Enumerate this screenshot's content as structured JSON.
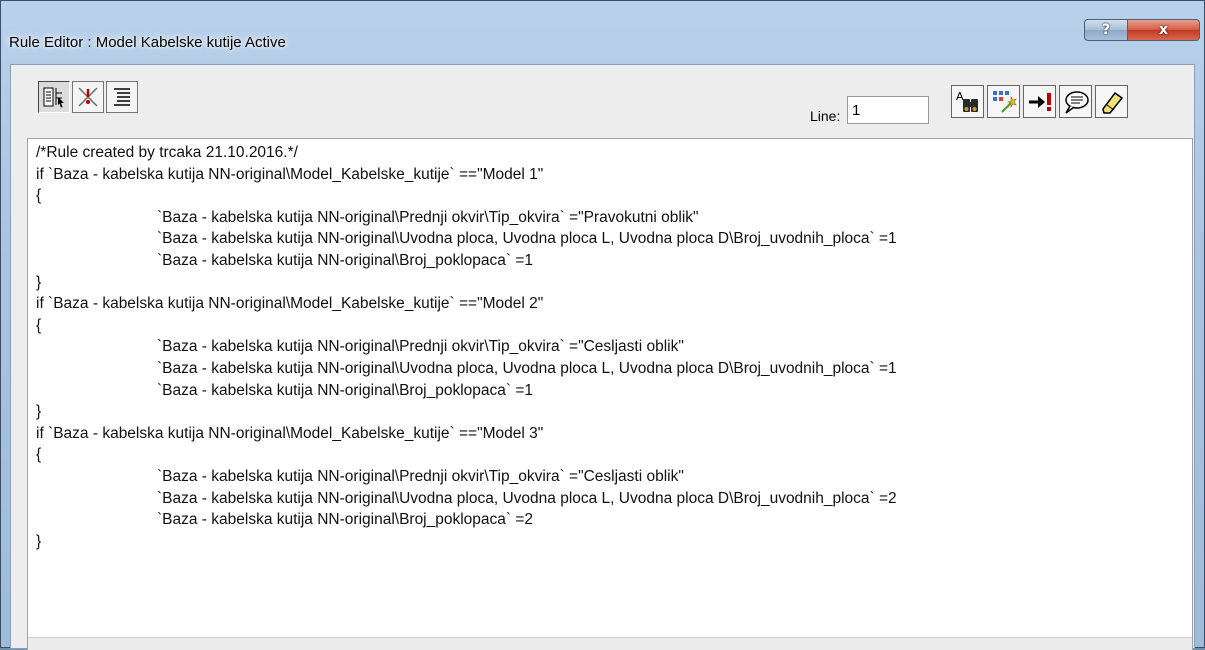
{
  "window": {
    "title": "Rule Editor : Model Kabelske kutije Active",
    "help_label": "?",
    "close_label": "x"
  },
  "toolbar": {
    "left_buttons": [
      {
        "icon": "rule-browser-icon"
      },
      {
        "icon": "diagnose-icon"
      },
      {
        "icon": "formatting-icon"
      }
    ],
    "line_label": "Line:",
    "line_value": "1",
    "right_buttons": [
      {
        "icon": "find-binoculars-icon"
      },
      {
        "icon": "dictionary-wizard-icon"
      },
      {
        "icon": "go-to-error-icon"
      },
      {
        "icon": "comment-bubble-icon"
      },
      {
        "icon": "eraser-icon"
      }
    ]
  },
  "editor": {
    "lines": [
      {
        "text": "/*Rule created by trcaka 21.10.2016.*/",
        "indent": false
      },
      {
        "text": "if `Baza - kabelska kutija NN-original\\Model_Kabelske_kutije` ==\"Model 1\"",
        "indent": false
      },
      {
        "text": "{",
        "indent": false
      },
      {
        "text": "`Baza - kabelska kutija NN-original\\Prednji okvir\\Tip_okvira` =\"Pravokutni oblik\"",
        "indent": true
      },
      {
        "text": "`Baza - kabelska kutija NN-original\\Uvodna ploca, Uvodna ploca L, Uvodna ploca D\\Broj_uvodnih_ploca` =1",
        "indent": true
      },
      {
        "text": "`Baza - kabelska kutija NN-original\\Broj_poklopaca` =1",
        "indent": true
      },
      {
        "text": "}",
        "indent": false
      },
      {
        "text": "if `Baza - kabelska kutija NN-original\\Model_Kabelske_kutije` ==\"Model 2\"",
        "indent": false
      },
      {
        "text": "{",
        "indent": false
      },
      {
        "text": "`Baza - kabelska kutija NN-original\\Prednji okvir\\Tip_okvira` =\"Cesljasti oblik\"",
        "indent": true
      },
      {
        "text": "`Baza - kabelska kutija NN-original\\Uvodna ploca, Uvodna ploca L, Uvodna ploca D\\Broj_uvodnih_ploca` =1",
        "indent": true
      },
      {
        "text": "`Baza - kabelska kutija NN-original\\Broj_poklopaca` =1",
        "indent": true
      },
      {
        "text": "}",
        "indent": false
      },
      {
        "text": "if `Baza - kabelska kutija NN-original\\Model_Kabelske_kutije` ==\"Model 3\"",
        "indent": false
      },
      {
        "text": "{",
        "indent": false
      },
      {
        "text": "`Baza - kabelska kutija NN-original\\Prednji okvir\\Tip_okvira` =\"Cesljasti oblik\"",
        "indent": true
      },
      {
        "text": "`Baza - kabelska kutija NN-original\\Uvodna ploca, Uvodna ploca L, Uvodna ploca D\\Broj_uvodnih_ploca` =2",
        "indent": true
      },
      {
        "text": "`Baza - kabelska kutija NN-original\\Broj_poklopaca` =2",
        "indent": true
      },
      {
        "text": "}",
        "indent": false
      }
    ]
  }
}
